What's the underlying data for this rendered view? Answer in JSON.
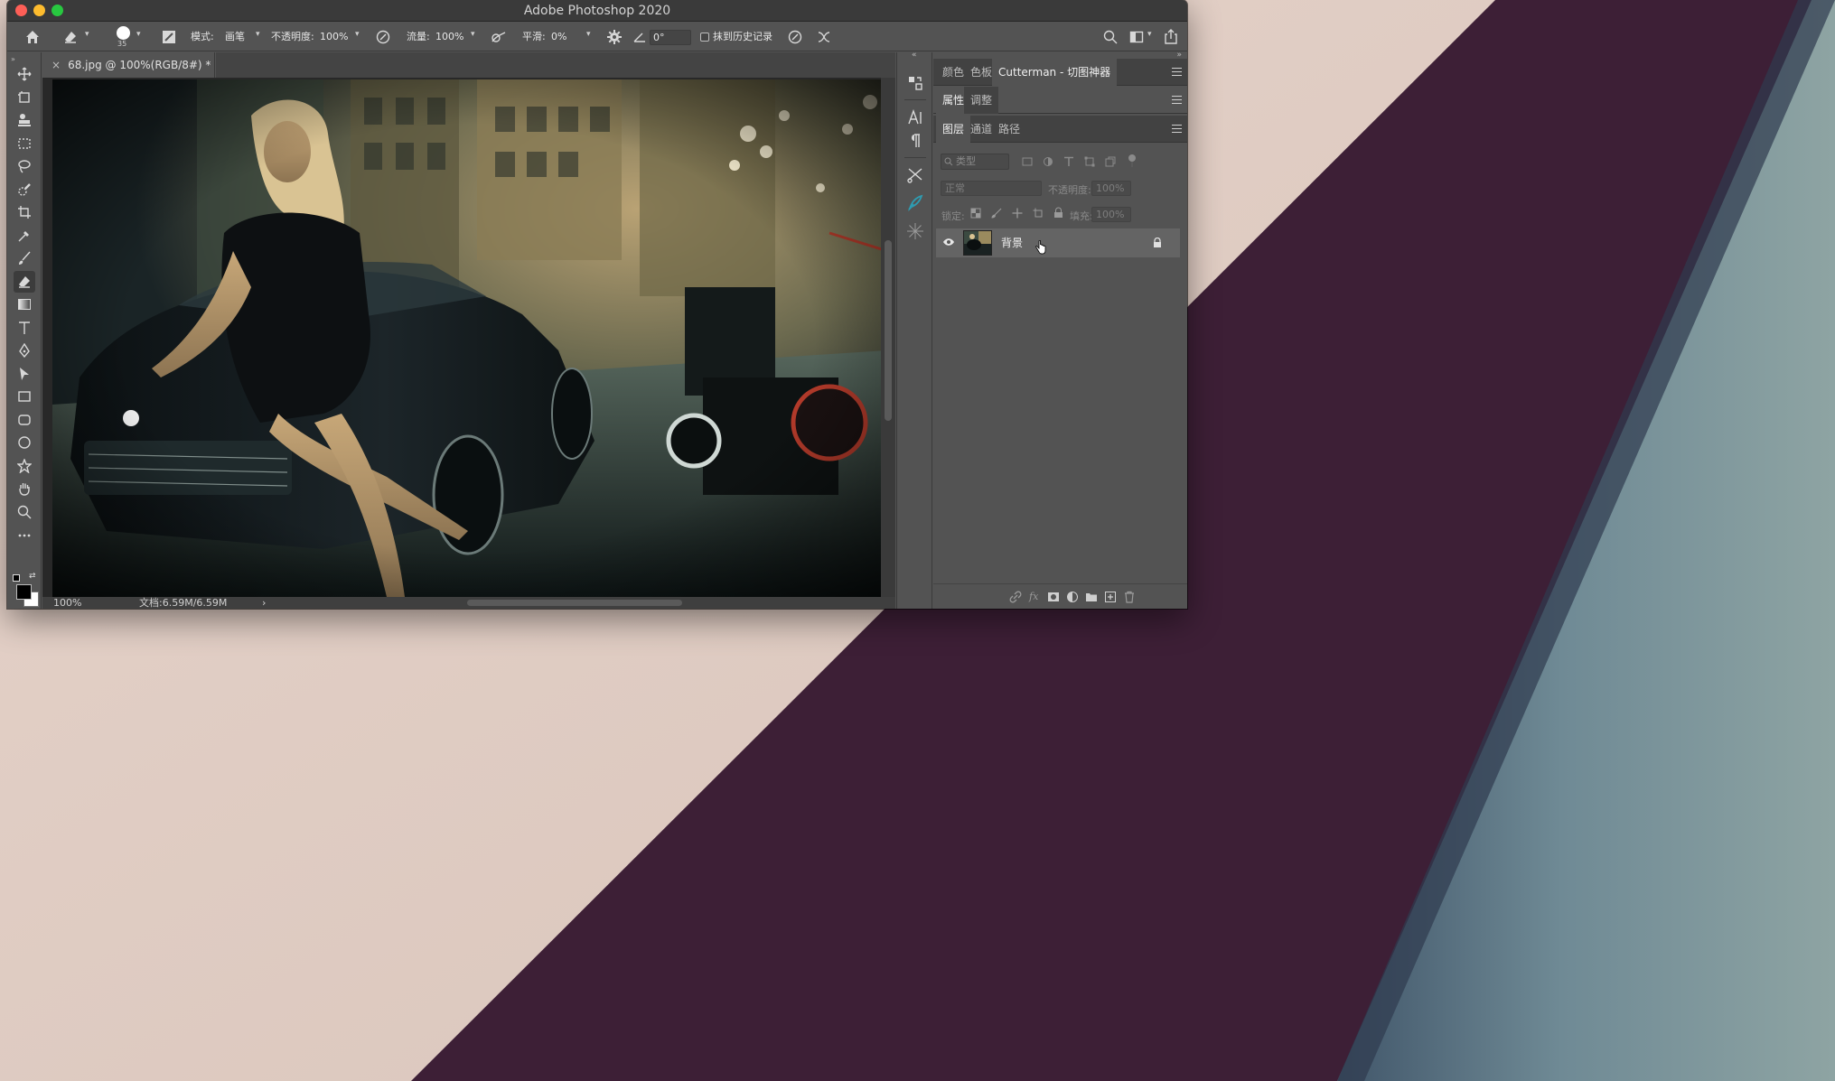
{
  "window": {
    "title": "Adobe Photoshop 2020"
  },
  "options_bar": {
    "brush_size": "35",
    "mode_label": "模式:",
    "mode_value": "画笔",
    "opacity_label": "不透明度:",
    "opacity_value": "100%",
    "flow_label": "流量:",
    "flow_value": "100%",
    "smoothing_label": "平滑:",
    "smoothing_value": "0%",
    "angle_value": "0°",
    "erase_history_label": "抹到历史记录"
  },
  "document": {
    "tab_title": "68.jpg @ 100%(RGB/8#) *",
    "close_glyph": "×"
  },
  "status_bar": {
    "zoom": "100%",
    "doc_info": "文档:6.59M/6.59M",
    "arrow": "›"
  },
  "panels": {
    "group1_tabs": [
      "颜色",
      "色板",
      "Cutterman - 切图神器"
    ],
    "group2_tabs": [
      "属性",
      "调整"
    ],
    "group3_tabs": [
      "图层",
      "通道",
      "路径"
    ],
    "filter_placeholder": "类型",
    "blend_mode": "正常",
    "opacity_label": "不透明度:",
    "opacity_value": "100%",
    "lock_label": "锁定:",
    "fill_label": "填充:",
    "fill_value": "100%"
  },
  "layers": [
    {
      "name": "背景",
      "visible": true,
      "locked": true
    }
  ],
  "colors": {
    "accent_teal": "#2f9bb0",
    "panel_bg": "#535353",
    "wallpaper_plum": "#3e1f36",
    "wallpaper_blush": "#dcc9c0"
  }
}
